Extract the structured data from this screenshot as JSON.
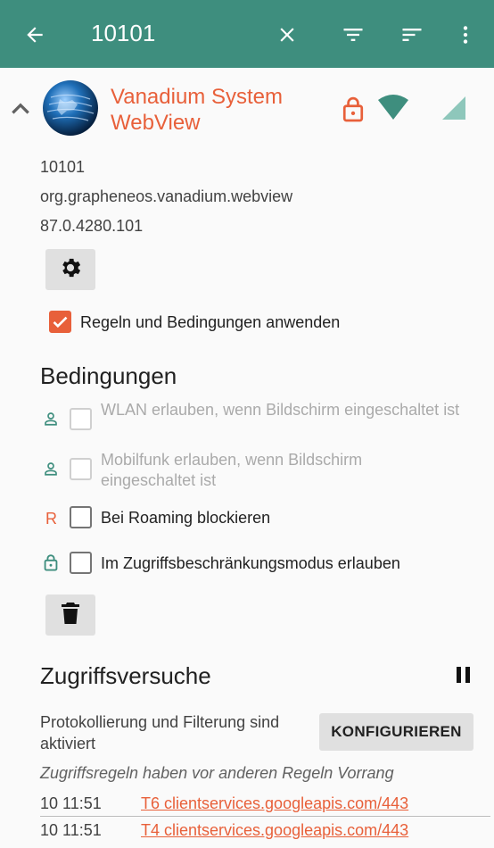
{
  "toolbar": {
    "query": "10101",
    "icons": [
      "back-arrow-icon",
      "close-icon",
      "filter-icon",
      "sort-icon",
      "more-vert-icon"
    ]
  },
  "app": {
    "name": "Vanadium System WebView",
    "uid": "10101",
    "package": "org.grapheneos.vanadium.webview",
    "version": "87.0.4280.101"
  },
  "apply_rules": {
    "label": "Regeln und Bedingungen anwenden",
    "checked": true
  },
  "conditions": {
    "title": "Bedingungen",
    "items": [
      {
        "tag": "",
        "label": "WLAN erlauben, wenn Bildschirm eingeschaltet ist",
        "enabled": false,
        "checked": false
      },
      {
        "tag": "",
        "label": "Mobilfunk erlauben, wenn Bildschirm eingeschaltet ist",
        "enabled": false,
        "checked": false
      },
      {
        "tag": "R",
        "label": "Bei Roaming blockieren",
        "enabled": true,
        "checked": false
      },
      {
        "tag": "",
        "label": "Im Zugriffsbeschränkungsmodus erlauben",
        "enabled": true,
        "checked": false
      }
    ]
  },
  "access": {
    "title": "Zugriffsversuche",
    "status": "Protokollierung und Filterung sind aktiviert",
    "configure_label": "KONFIGURIEREN",
    "note": "Zugriffsregeln haben vor anderen Regeln Vorrang",
    "log": [
      {
        "time": "10 11:51",
        "entry": "T6 clientservices.googleapis.com/443"
      },
      {
        "time": "10 11:51",
        "entry": "T4 clientservices.googleapis.com/443"
      }
    ]
  },
  "colors": {
    "toolbar": "#3e8e7e",
    "accent": "#e8603a",
    "teal": "#3e8e7e"
  }
}
